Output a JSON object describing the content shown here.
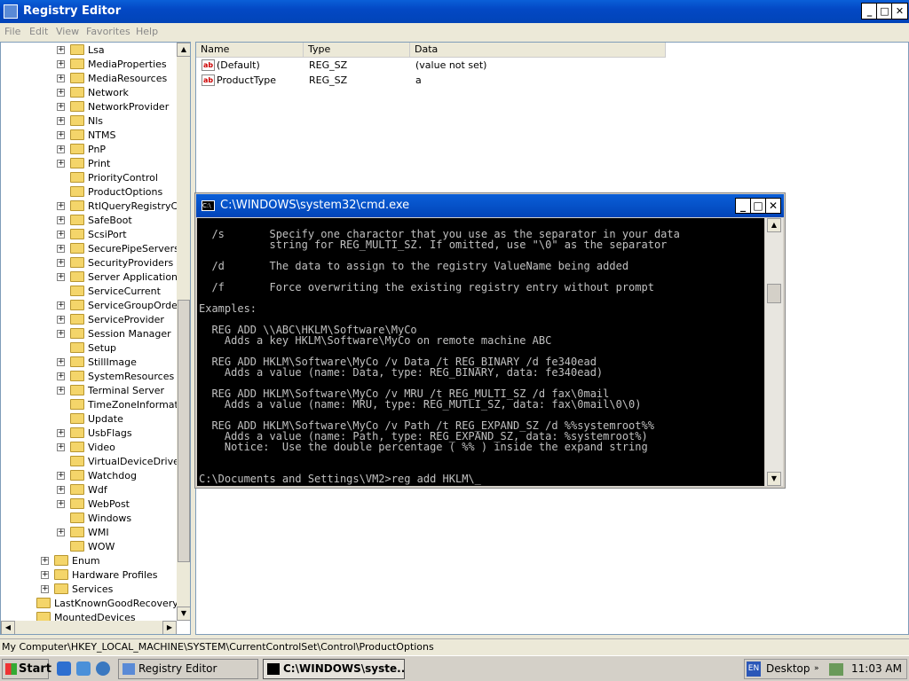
{
  "window": {
    "title": "Registry Editor",
    "minimize": "_",
    "maximize": "□",
    "close": "✕"
  },
  "menu": [
    "File",
    "Edit",
    "View",
    "Favorites",
    "Help"
  ],
  "tree": [
    {
      "label": "Lsa",
      "level": 3,
      "exp": true
    },
    {
      "label": "MediaProperties",
      "level": 3,
      "exp": true
    },
    {
      "label": "MediaResources",
      "level": 3,
      "exp": true
    },
    {
      "label": "Network",
      "level": 3,
      "exp": true
    },
    {
      "label": "NetworkProvider",
      "level": 3,
      "exp": true
    },
    {
      "label": "Nls",
      "level": 3,
      "exp": true
    },
    {
      "label": "NTMS",
      "level": 3,
      "exp": true
    },
    {
      "label": "PnP",
      "level": 3,
      "exp": true
    },
    {
      "label": "Print",
      "level": 3,
      "exp": true
    },
    {
      "label": "PriorityControl",
      "level": 3,
      "exp": false
    },
    {
      "label": "ProductOptions",
      "level": 3,
      "exp": false,
      "selected": true
    },
    {
      "label": "RtlQueryRegistryCor",
      "level": 3,
      "exp": true
    },
    {
      "label": "SafeBoot",
      "level": 3,
      "exp": true
    },
    {
      "label": "ScsiPort",
      "level": 3,
      "exp": true
    },
    {
      "label": "SecurePipeServers",
      "level": 3,
      "exp": true
    },
    {
      "label": "SecurityProviders",
      "level": 3,
      "exp": true
    },
    {
      "label": "Server Applications",
      "level": 3,
      "exp": true
    },
    {
      "label": "ServiceCurrent",
      "level": 3,
      "exp": false
    },
    {
      "label": "ServiceGroupOrder",
      "level": 3,
      "exp": true
    },
    {
      "label": "ServiceProvider",
      "level": 3,
      "exp": true
    },
    {
      "label": "Session Manager",
      "level": 3,
      "exp": true
    },
    {
      "label": "Setup",
      "level": 3,
      "exp": false
    },
    {
      "label": "StillImage",
      "level": 3,
      "exp": true
    },
    {
      "label": "SystemResources",
      "level": 3,
      "exp": true
    },
    {
      "label": "Terminal Server",
      "level": 3,
      "exp": true
    },
    {
      "label": "TimeZoneInformatior",
      "level": 3,
      "exp": false
    },
    {
      "label": "Update",
      "level": 3,
      "exp": false
    },
    {
      "label": "UsbFlags",
      "level": 3,
      "exp": true
    },
    {
      "label": "Video",
      "level": 3,
      "exp": true
    },
    {
      "label": "VirtualDeviceDrivers",
      "level": 3,
      "exp": false
    },
    {
      "label": "Watchdog",
      "level": 3,
      "exp": true
    },
    {
      "label": "Wdf",
      "level": 3,
      "exp": true
    },
    {
      "label": "WebPost",
      "level": 3,
      "exp": true
    },
    {
      "label": "Windows",
      "level": 3,
      "exp": false
    },
    {
      "label": "WMI",
      "level": 3,
      "exp": true
    },
    {
      "label": "WOW",
      "level": 3,
      "exp": false
    },
    {
      "label": "Enum",
      "level": 2,
      "exp": true
    },
    {
      "label": "Hardware Profiles",
      "level": 2,
      "exp": true
    },
    {
      "label": "Services",
      "level": 2,
      "exp": true
    },
    {
      "label": "LastKnownGoodRecovery",
      "level": 1,
      "exp": false
    },
    {
      "label": "MountedDevices",
      "level": 1,
      "exp": false
    }
  ],
  "list": {
    "columns": [
      "Name",
      "Type",
      "Data"
    ],
    "rows": [
      {
        "name": "(Default)",
        "type": "REG_SZ",
        "data": "(value not set)"
      },
      {
        "name": "ProductType",
        "type": "REG_SZ",
        "data": "a"
      }
    ]
  },
  "statusbar": "My Computer\\HKEY_LOCAL_MACHINE\\SYSTEM\\CurrentControlSet\\Control\\ProductOptions",
  "cmd": {
    "title": "C:\\WINDOWS\\system32\\cmd.exe",
    "icon_text": "C:\\",
    "lines": [
      "",
      "  /s       Specify one charactor that you use as the separator in your data",
      "           string for REG_MULTI_SZ. If omitted, use \"\\0\" as the separator",
      "",
      "  /d       The data to assign to the registry ValueName being added",
      "",
      "  /f       Force overwriting the existing registry entry without prompt",
      "",
      "Examples:",
      "",
      "  REG ADD \\\\ABC\\HKLM\\Software\\MyCo",
      "    Adds a key HKLM\\Software\\MyCo on remote machine ABC",
      "",
      "  REG ADD HKLM\\Software\\MyCo /v Data /t REG_BINARY /d fe340ead",
      "    Adds a value (name: Data, type: REG_BINARY, data: fe340ead)",
      "",
      "  REG ADD HKLM\\Software\\MyCo /v MRU /t REG_MULTI_SZ /d fax\\0mail",
      "    Adds a value (name: MRU, type: REG_MUTLI_SZ, data: fax\\0mail\\0\\0)",
      "",
      "  REG ADD HKLM\\Software\\MyCo /v Path /t REG_EXPAND_SZ /d %%systemroot%%",
      "    Adds a value (name: Path, type: REG_EXPAND_SZ, data: %systemroot%)",
      "    Notice:  Use the double percentage ( %% ) inside the expand string",
      "",
      "",
      "C:\\Documents and Settings\\VM2>reg add HKLM\\_"
    ]
  },
  "taskbar": {
    "start": "Start",
    "buttons": [
      {
        "label": "Registry Editor",
        "active": false
      },
      {
        "label": "C:\\WINDOWS\\syste...",
        "active": true
      }
    ],
    "lang": "EN",
    "desktop": "Desktop",
    "clock": "11:03 AM"
  }
}
